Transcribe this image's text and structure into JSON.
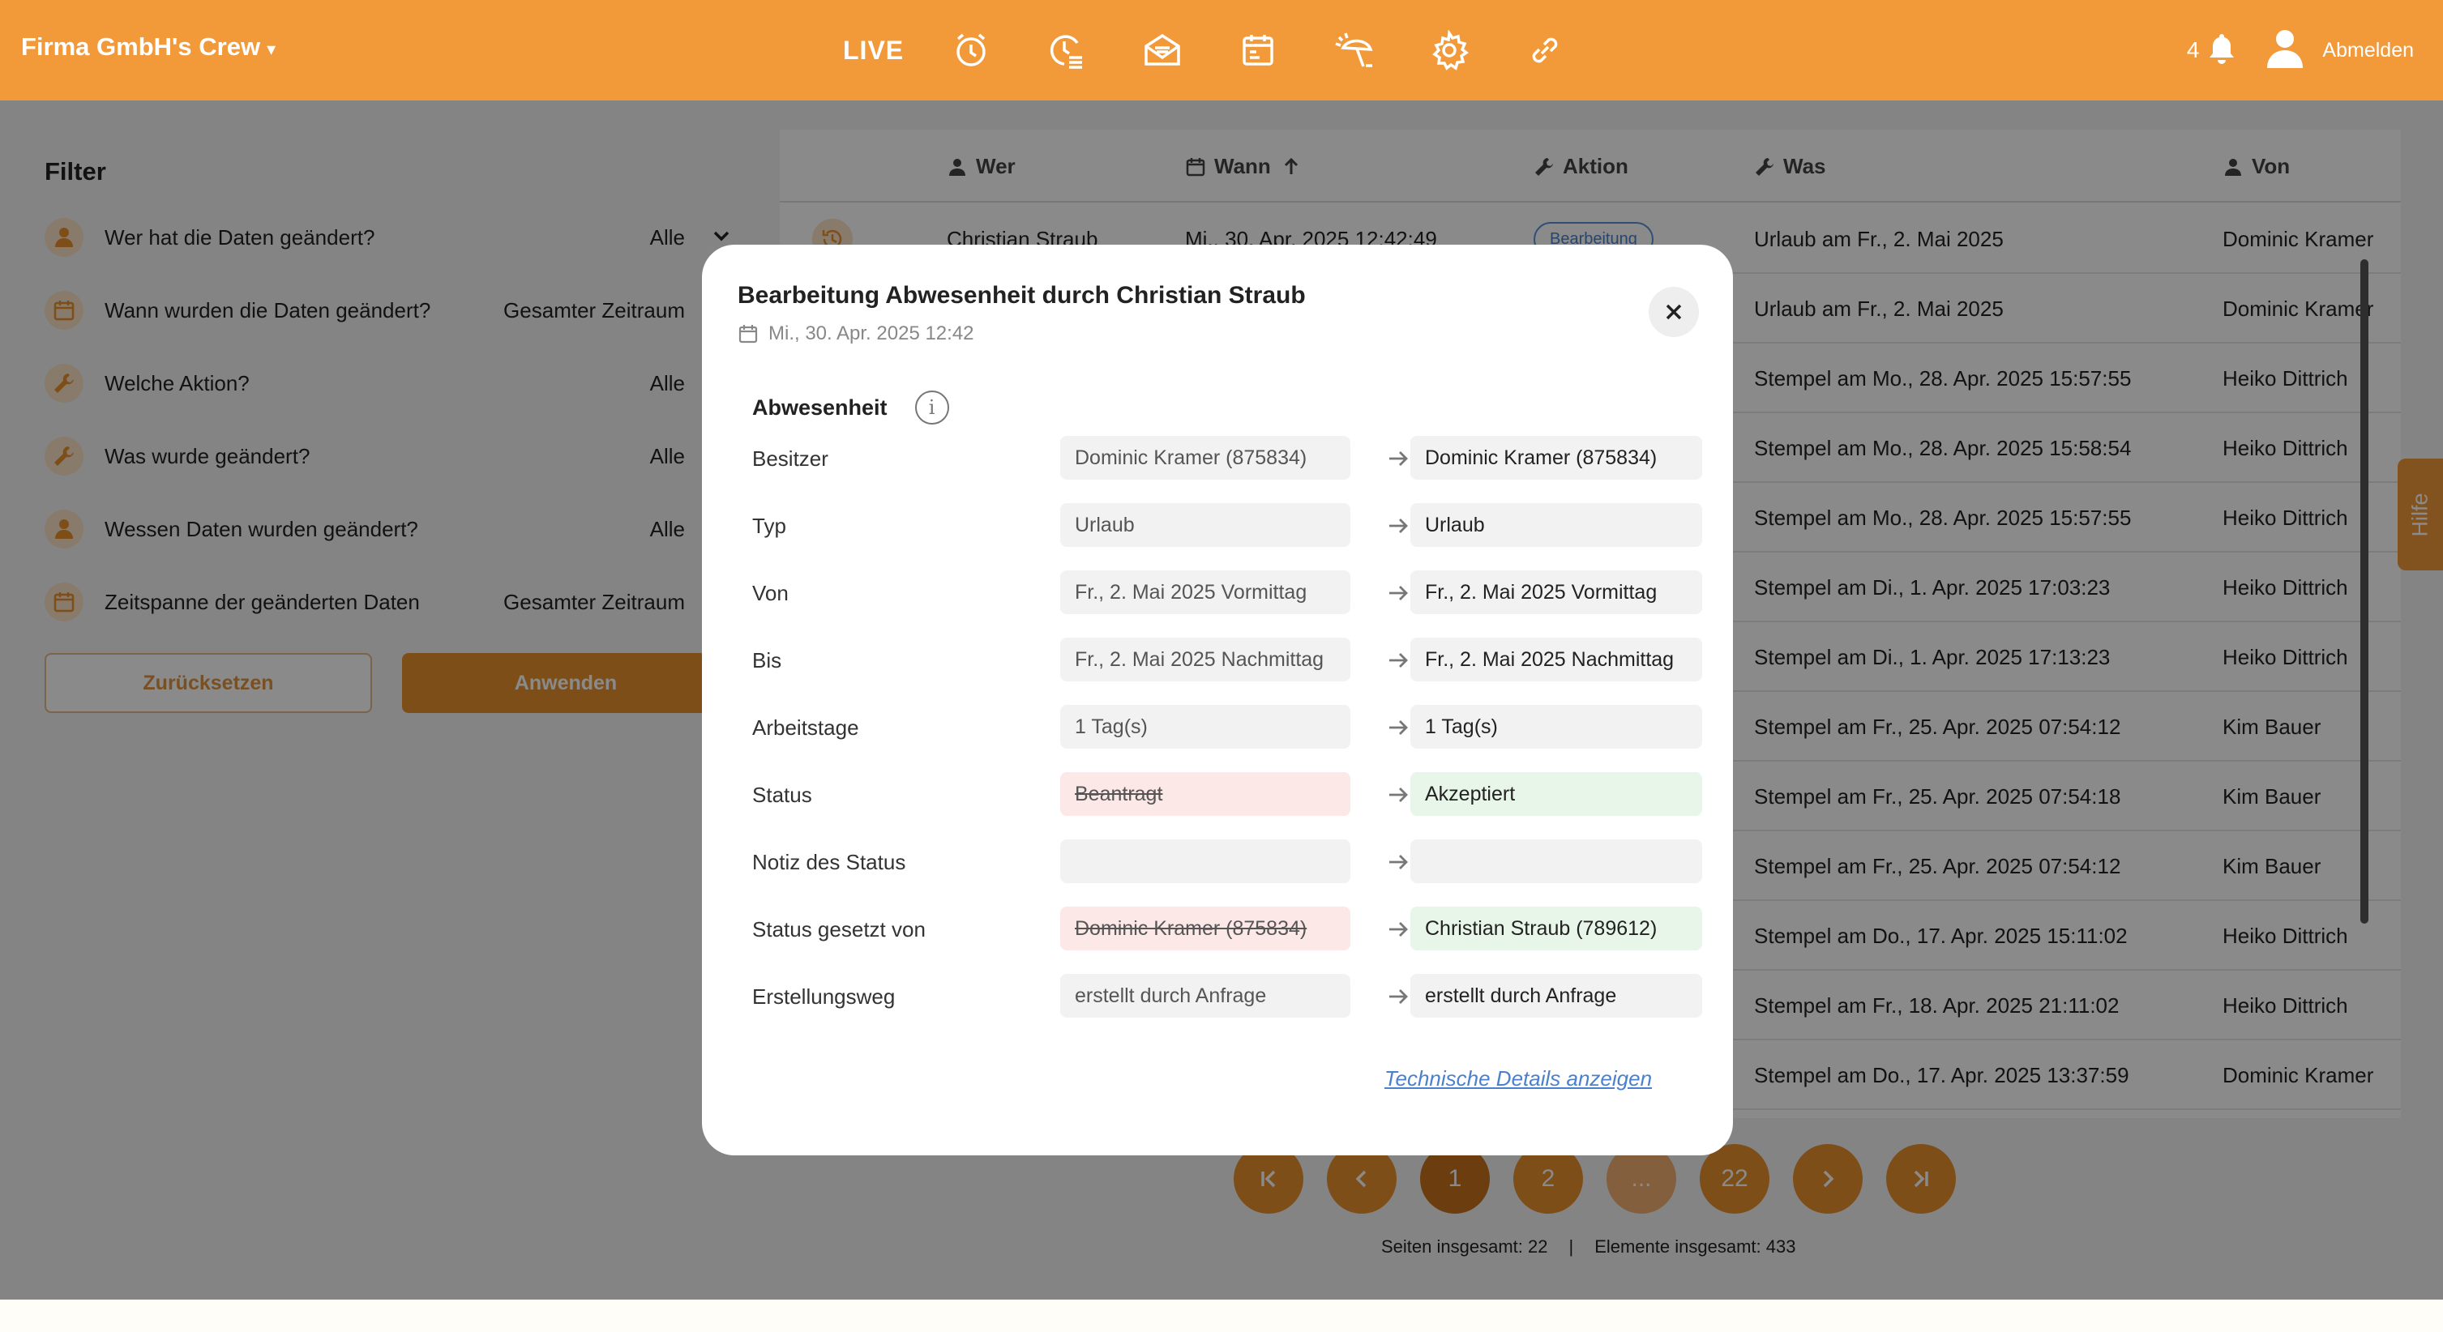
{
  "header": {
    "brand": "Firma GmbH's Crew",
    "brand_caret": "▾",
    "live": "LIVE",
    "nav_icons": [
      "alarm-clock-icon",
      "timeline-icon",
      "mail-icon",
      "calendar-icon",
      "vacation-icon",
      "settings-icon",
      "link-icon"
    ],
    "notification_count": "4",
    "logout": "Abmelden"
  },
  "filter": {
    "title": "Filter",
    "rows": [
      {
        "label": "Wer hat die Daten geändert?",
        "value": "Alle"
      },
      {
        "label": "Wann wurden die Daten geändert?",
        "value": "Gesamter Zeitraum"
      },
      {
        "label": "Welche Aktion?",
        "value": "Alle"
      },
      {
        "label": "Was wurde geändert?",
        "value": "Alle"
      },
      {
        "label": "Wessen Daten wurden geändert?",
        "value": "Alle"
      },
      {
        "label": "Zeitspanne der geänderten Daten",
        "value": "Gesamter Zeitraum"
      }
    ],
    "reset": "Zurücksetzen",
    "apply": "Anwenden"
  },
  "table": {
    "headers": {
      "wer": "Wer",
      "wann": "Wann",
      "aktion": "Aktion",
      "was": "Was",
      "von": "Von"
    },
    "rows": [
      {
        "wer": "Christian Straub",
        "wann": "Mi., 30. Apr. 2025 12:42:49",
        "aktion": "Bearbeitung",
        "was": "Urlaub am Fr., 2. Mai 2025",
        "von": "Dominic Kramer"
      },
      {
        "wer": "",
        "wann": "",
        "aktion": "",
        "was": "Urlaub am Fr., 2. Mai 2025",
        "von": "Dominic Kramer"
      },
      {
        "wer": "",
        "wann": "",
        "aktion": "",
        "was": "Stempel am Mo., 28. Apr. 2025 15:57:55",
        "von": "Heiko Dittrich"
      },
      {
        "wer": "",
        "wann": "",
        "aktion": "",
        "was": "Stempel am Mo., 28. Apr. 2025 15:58:54",
        "von": "Heiko Dittrich"
      },
      {
        "wer": "",
        "wann": "",
        "aktion": "",
        "was": "Stempel am Mo., 28. Apr. 2025 15:57:55",
        "von": "Heiko Dittrich"
      },
      {
        "wer": "",
        "wann": "",
        "aktion": "",
        "was": "Stempel am Di., 1. Apr. 2025 17:03:23",
        "von": "Heiko Dittrich"
      },
      {
        "wer": "",
        "wann": "",
        "aktion": "",
        "was": "Stempel am Di., 1. Apr. 2025 17:13:23",
        "von": "Heiko Dittrich"
      },
      {
        "wer": "",
        "wann": "",
        "aktion": "",
        "was": "Stempel am Fr., 25. Apr. 2025 07:54:12",
        "von": "Kim Bauer"
      },
      {
        "wer": "",
        "wann": "",
        "aktion": "",
        "was": "Stempel am Fr., 25. Apr. 2025 07:54:18",
        "von": "Kim Bauer"
      },
      {
        "wer": "",
        "wann": "",
        "aktion": "",
        "was": "Stempel am Fr., 25. Apr. 2025 07:54:12",
        "von": "Kim Bauer"
      },
      {
        "wer": "",
        "wann": "",
        "aktion": "",
        "was": "Stempel am Do., 17. Apr. 2025 15:11:02",
        "von": "Heiko Dittrich"
      },
      {
        "wer": "",
        "wann": "",
        "aktion": "",
        "was": "Stempel am Fr., 18. Apr. 2025 21:11:02",
        "von": "Heiko Dittrich"
      },
      {
        "wer": "",
        "wann": "",
        "aktion": "",
        "was": "Stempel am Do., 17. Apr. 2025 13:37:59",
        "von": "Dominic Kramer"
      }
    ]
  },
  "pagination": {
    "pages": [
      "1",
      "2",
      "...",
      "22"
    ],
    "current": "1",
    "pages_total": "Seiten insgesamt: 22",
    "separator": "|",
    "elements_total": "Elemente insgesamt: 433"
  },
  "help": "Hilfe",
  "modal": {
    "title": "Bearbeitung Abwesenheit durch Christian Straub",
    "date": "Mi., 30. Apr. 2025 12:42",
    "section": "Abwesenheit",
    "info_glyph": "i",
    "rows": [
      {
        "label": "Besitzer",
        "old": "Dominic Kramer (875834)",
        "new": "Dominic Kramer (875834)"
      },
      {
        "label": "Typ",
        "old": "Urlaub",
        "new": "Urlaub"
      },
      {
        "label": "Von",
        "old": "Fr., 2. Mai 2025 Vormittag",
        "new": "Fr., 2. Mai 2025 Vormittag"
      },
      {
        "label": "Bis",
        "old": "Fr., 2. Mai 2025 Nachmittag",
        "new": "Fr., 2. Mai 2025 Nachmittag"
      },
      {
        "label": "Arbeitstage",
        "old": "1 Tag(s)",
        "new": "1 Tag(s)"
      },
      {
        "label": "Status",
        "old": "Beantragt",
        "new": "Akzeptiert"
      },
      {
        "label": "Notiz des Status",
        "old": "",
        "new": ""
      },
      {
        "label": "Status gesetzt von",
        "old": "Dominic Kramer (875834)",
        "new": "Christian Straub (789612)"
      },
      {
        "label": "Erstellungsweg",
        "old": "erstellt durch Anfrage",
        "new": "erstellt durch Anfrage"
      }
    ],
    "tech_link": "Technische Details anzeigen"
  },
  "colors": {
    "brand": "#f29a3a",
    "accent": "#e8902d",
    "removed_bg": "#fde8e8",
    "added_bg": "#e8f5e9",
    "link": "#4a80cc"
  }
}
